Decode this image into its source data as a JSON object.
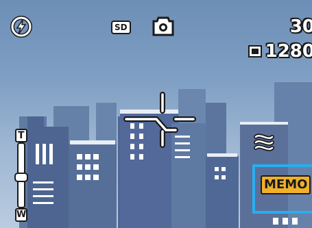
{
  "status_bar": {
    "flash_icon": "flash-auto-icon",
    "sd_label": "SD",
    "mode_icon": "camera-icon",
    "shots_remaining": "30",
    "image_size_icon": "image-size-icon",
    "resolution": "1280"
  },
  "zoom": {
    "tele_label": "T",
    "wide_label": "W",
    "level": 0.55
  },
  "focus_frame_icon": "af-target-icon",
  "right_panel": {
    "scene_icon": "snow-scene-icon",
    "memo_label": "MEMO",
    "selection_color": "#27aef0"
  },
  "colors": {
    "sky": "#7f9fc3",
    "buildings": "#5a7198",
    "memo_bg": "#f0b02a"
  }
}
